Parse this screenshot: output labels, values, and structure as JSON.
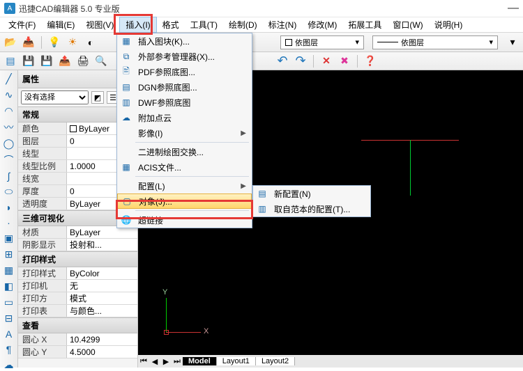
{
  "title": "迅捷CAD编辑器 5.0 专业版",
  "menubar": {
    "file": "文件(F)",
    "edit": "编辑(E)",
    "view": "视图(V)",
    "insert": "插入(I)",
    "format": "格式",
    "tools": "工具(T)",
    "draw": "绘制(D)",
    "annotate": "标注(N)",
    "modify": "修改(M)",
    "extend": "拓展工具",
    "window": "窗口(W)",
    "help": "说明(H)"
  },
  "toolbar": {
    "layer_label": "依图层",
    "layer_label2": "依图层"
  },
  "properties": {
    "panel_title": "属性",
    "selector": "没有选择",
    "sections": {
      "general": "常规",
      "visual3d": "三维可视化",
      "plotstyle": "打印样式",
      "view": "查看"
    },
    "rows": {
      "color_k": "颜色",
      "color_v": "ByLayer",
      "layer_k": "图层",
      "layer_v": "0",
      "ltype_k": "线型",
      "ltype_v": "",
      "ltscale_k": "线型比例",
      "ltscale_v": "1.0000",
      "lweight_k": "线宽",
      "lweight_v": "",
      "thick_k": "厚度",
      "thick_v": "0",
      "transp_k": "透明度",
      "transp_v": "ByLayer",
      "material_k": "材质",
      "material_v": "ByLayer",
      "shadow_k": "阴影显示",
      "shadow_v": "投射和...",
      "pstyle_k": "打印样式",
      "pstyle_v": "ByColor",
      "printer_k": "打印机",
      "printer_v": "无",
      "pmode_k": "打印方",
      "pmode_v": "模式",
      "ptable_k": "打印表",
      "ptable_v": "与颜色...",
      "cx_k": "圆心 X",
      "cx_v": "10.4299",
      "cy_k": "圆心 Y",
      "cy_v": "4.5000"
    }
  },
  "insert_menu": {
    "block": "插入图块(K)...",
    "xref": "外部参考管理器(X)...",
    "pdf": "PDF参照底图...",
    "dgn": "DGN参照底图...",
    "dwf": "DWF参照底图",
    "pointcloud": "附加点云",
    "image": "影像(I)",
    "binexch": "二进制绘图交换...",
    "acis": "ACIS文件...",
    "config": "配置(L)",
    "object": "对象(J)...",
    "hyperlink": "超链接"
  },
  "config_submenu": {
    "new": "新配置(N)",
    "fromtpl": "取自范本的配置(T)..."
  },
  "tabs": {
    "model": "Model",
    "layout1": "Layout1",
    "layout2": "Layout2"
  },
  "axis": {
    "x": "X",
    "y": "Y"
  }
}
